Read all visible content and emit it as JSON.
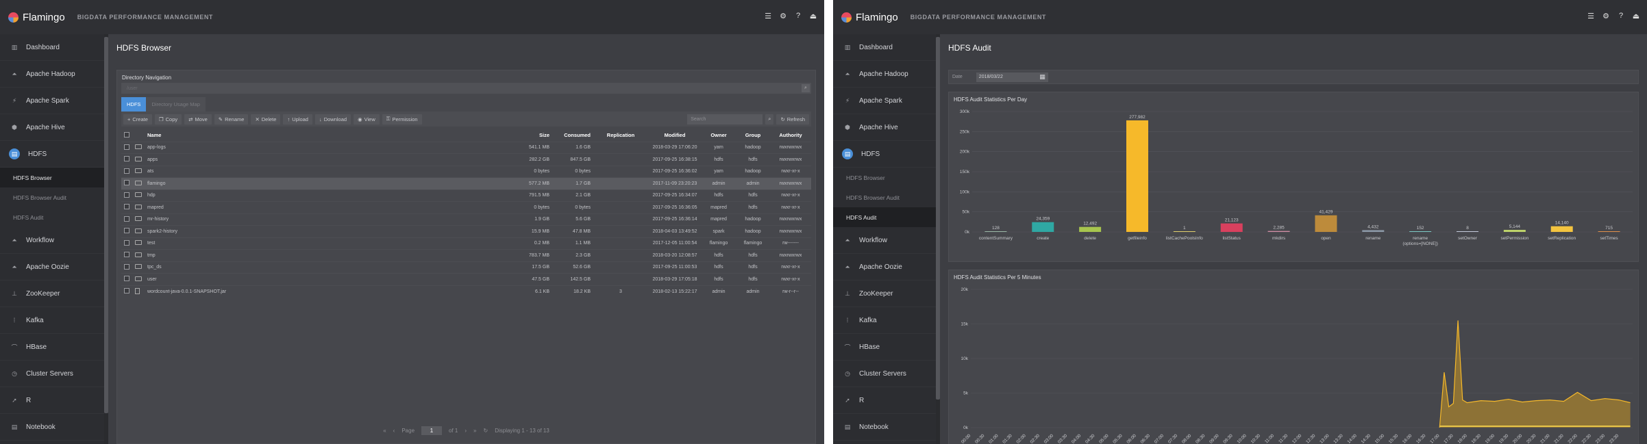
{
  "app": {
    "name": "Flamingo",
    "subtitle": "BIGDATA PERFORMANCE MANAGEMENT"
  },
  "top_icons": [
    {
      "name": "menu-icon",
      "glyph": "☰"
    },
    {
      "name": "gear-icon",
      "glyph": "⚙"
    },
    {
      "name": "help-icon",
      "glyph": "?"
    },
    {
      "name": "logout-icon",
      "glyph": "⏏"
    }
  ],
  "sidebar": {
    "items": [
      {
        "label": "Dashboard",
        "icon": "chart-icon",
        "glyph": "▥"
      },
      {
        "label": "Apache Hadoop",
        "icon": "hadoop-icon",
        "glyph": "⏶"
      },
      {
        "label": "Apache Spark",
        "icon": "spark-icon",
        "glyph": "⚡"
      },
      {
        "label": "Apache Hive",
        "icon": "hive-icon",
        "glyph": "⬢"
      },
      {
        "label": "HDFS",
        "icon": "hdfs-icon",
        "glyph": "▤",
        "open": true
      },
      {
        "label": "Workflow",
        "icon": "workflow-icon",
        "glyph": "⏶"
      },
      {
        "label": "Apache Oozie",
        "icon": "oozie-icon",
        "glyph": "⏶"
      },
      {
        "label": "ZooKeeper",
        "icon": "zookeeper-icon",
        "glyph": "⊥"
      },
      {
        "label": "Kafka",
        "icon": "kafka-icon",
        "glyph": "⁞"
      },
      {
        "label": "HBase",
        "icon": "hbase-icon",
        "glyph": "⌒"
      },
      {
        "label": "Cluster Servers",
        "icon": "servers-icon",
        "glyph": "◷"
      },
      {
        "label": "R",
        "icon": "rocket-icon",
        "glyph": "➚"
      },
      {
        "label": "Notebook",
        "icon": "notebook-icon",
        "glyph": "▤"
      }
    ],
    "hdfs_sub": [
      "HDFS Browser",
      "HDFS Browser Audit",
      "HDFS Audit"
    ]
  },
  "left": {
    "title": "HDFS Browser",
    "dir_nav": {
      "title": "Directory Navigation",
      "path_placeholder": "/user"
    },
    "tabs": [
      "HDFS",
      "Directory Usage Map"
    ],
    "toolbar": [
      "Create",
      "Copy",
      "Move",
      "Rename",
      "Delete",
      "Upload",
      "Download",
      "View",
      "Permission"
    ],
    "search_placeholder": "Search",
    "refresh": "Refresh",
    "columns": [
      "Name",
      "Size",
      "Consumed",
      "Replication",
      "Modified",
      "Owner",
      "Group",
      "Authority"
    ],
    "rows": [
      [
        "app-logs",
        "541.1 MB",
        "1.6 GB",
        "",
        "2018-03-29 17:06:20",
        "yarn",
        "hadoop",
        "rwxrwxrwx"
      ],
      [
        "apps",
        "282.2 GB",
        "847.5 GB",
        "",
        "2017-09-25 16:38:15",
        "hdfs",
        "hdfs",
        "rwxrwxrwx"
      ],
      [
        "ats",
        "0 bytes",
        "0 bytes",
        "",
        "2017-09-25 16:36:02",
        "yarn",
        "hadoop",
        "rwxr-xr-x"
      ],
      [
        "flamingo",
        "577.2 MB",
        "1.7 GB",
        "",
        "2017-11-09 23:20:23",
        "admin",
        "admin",
        "rwxrwxrwx"
      ],
      [
        "hdp",
        "791.5 MB",
        "2.1 GB",
        "",
        "2017-09-25 16:34:07",
        "hdfs",
        "hdfs",
        "rwxr-xr-x"
      ],
      [
        "mapred",
        "0 bytes",
        "0 bytes",
        "",
        "2017-09-25 16:36:05",
        "mapred",
        "hdfs",
        "rwxr-xr-x"
      ],
      [
        "mr-history",
        "1.9 GB",
        "5.6 GB",
        "",
        "2017-09-25 16:36:14",
        "mapred",
        "hadoop",
        "rwxrwxrwx"
      ],
      [
        "spark2-history",
        "15.9 MB",
        "47.8 MB",
        "",
        "2018-04-03 13:49:52",
        "spark",
        "hadoop",
        "rwxrwxrwx"
      ],
      [
        "test",
        "0.2 MB",
        "1.1 MB",
        "",
        "2017-12-05 11:00:54",
        "flamingo",
        "flamingo",
        "rw-------"
      ],
      [
        "tmp",
        "783.7 MB",
        "2.3 GB",
        "",
        "2018-03-20 12:08:57",
        "hdfs",
        "hdfs",
        "rwxrwxrwx"
      ],
      [
        "tpc_ds",
        "17.5 GB",
        "52.6 GB",
        "",
        "2017-09-25 11:00:53",
        "hdfs",
        "hdfs",
        "rwxr-xr-x"
      ],
      [
        "user",
        "47.5 GB",
        "142.5 GB",
        "",
        "2018-03-29 17:05:18",
        "hdfs",
        "hdfs",
        "rwxr-xr-x"
      ],
      [
        "wordcount-java-0.0.1-SNAPSHOT.jar",
        "6.1 KB",
        "18.2 KB",
        "3",
        "2018-02-13 15:22:17",
        "admin",
        "admin",
        "rw-r--r--"
      ]
    ],
    "pager": {
      "page_label": "Page",
      "page": "1",
      "of": "of 1",
      "displaying": "Displaying 1 - 13 of 13"
    }
  },
  "right": {
    "title": "HDFS Audit",
    "date_label": "Date",
    "date_value": "2018/03/22",
    "chart1_title": "HDFS Audit Statistics Per Day",
    "chart2_title": "HDFS Audit Statistics Per 5 Minutes"
  },
  "chart_data": [
    {
      "type": "bar",
      "title": "HDFS Audit Statistics Per Day",
      "categories": [
        "contentSummary",
        "create",
        "delete",
        "getfileinfo",
        "listCachePoolsInfo",
        "listStatus",
        "mkdirs",
        "open",
        "rename",
        "rename (options=[NONE])",
        "setOwner",
        "setPermission",
        "setReplication",
        "setTimes"
      ],
      "values": [
        128,
        24359,
        12492,
        277982,
        1,
        21123,
        2285,
        41429,
        4432,
        152,
        8,
        5144,
        14140,
        715
      ],
      "value_labels": [
        "128",
        "24,359",
        "12,492",
        "277,982",
        "1",
        "21,123",
        "2,285",
        "41,429",
        "4,432",
        "152",
        "8",
        "5,144",
        "14,140",
        "715"
      ],
      "colors": [
        "#9cb9a7",
        "#2fa8a3",
        "#a7c54e",
        "#f6b92a",
        "#e2d06c",
        "#d9405e",
        "#d18fa6",
        "#bd8b3b",
        "#8b98a6",
        "#7dc9c5",
        "#c4cbdc",
        "#bdd36a",
        "#f3c43f",
        "#e0904a"
      ],
      "y_ticks": [
        "0k",
        "50k",
        "100k",
        "150k",
        "200k",
        "250k",
        "300k"
      ],
      "ylim": [
        0,
        300000
      ]
    },
    {
      "type": "area",
      "title": "HDFS Audit Statistics Per 5 Minutes",
      "y_ticks": [
        "0k",
        "5k",
        "10k",
        "15k",
        "20k"
      ],
      "ylim": [
        0,
        20000
      ],
      "x_ticks": [
        "00:00",
        "00:30",
        "01:00",
        "01:30",
        "02:00",
        "02:30",
        "03:00",
        "03:30",
        "04:00",
        "04:30",
        "05:00",
        "05:30",
        "06:00",
        "06:30",
        "07:00",
        "07:30",
        "08:00",
        "08:30",
        "09:00",
        "09:30",
        "10:00",
        "10:30",
        "11:00",
        "11:30",
        "12:00",
        "12:30",
        "13:00",
        "13:30",
        "14:00",
        "14:30",
        "15:00",
        "15:30",
        "16:00",
        "16:30",
        "17:00",
        "17:30",
        "18:00",
        "18:30",
        "19:00",
        "19:30",
        "20:00",
        "20:30",
        "21:00",
        "21:30",
        "22:00",
        "22:30",
        "23:00",
        "23:30"
      ],
      "x": [
        "17:00",
        "17:10",
        "17:20",
        "17:30",
        "17:40",
        "17:50",
        "18:00",
        "18:30",
        "19:00",
        "19:30",
        "20:00",
        "20:30",
        "21:00",
        "21:30",
        "22:00",
        "22:30",
        "23:00",
        "23:30",
        "23:55"
      ],
      "values": [
        0,
        8000,
        3000,
        3500,
        15500,
        4000,
        3600,
        3900,
        3800,
        4100,
        3700,
        3900,
        4000,
        3800,
        5100,
        3900,
        4200,
        4000,
        3600
      ]
    }
  ]
}
